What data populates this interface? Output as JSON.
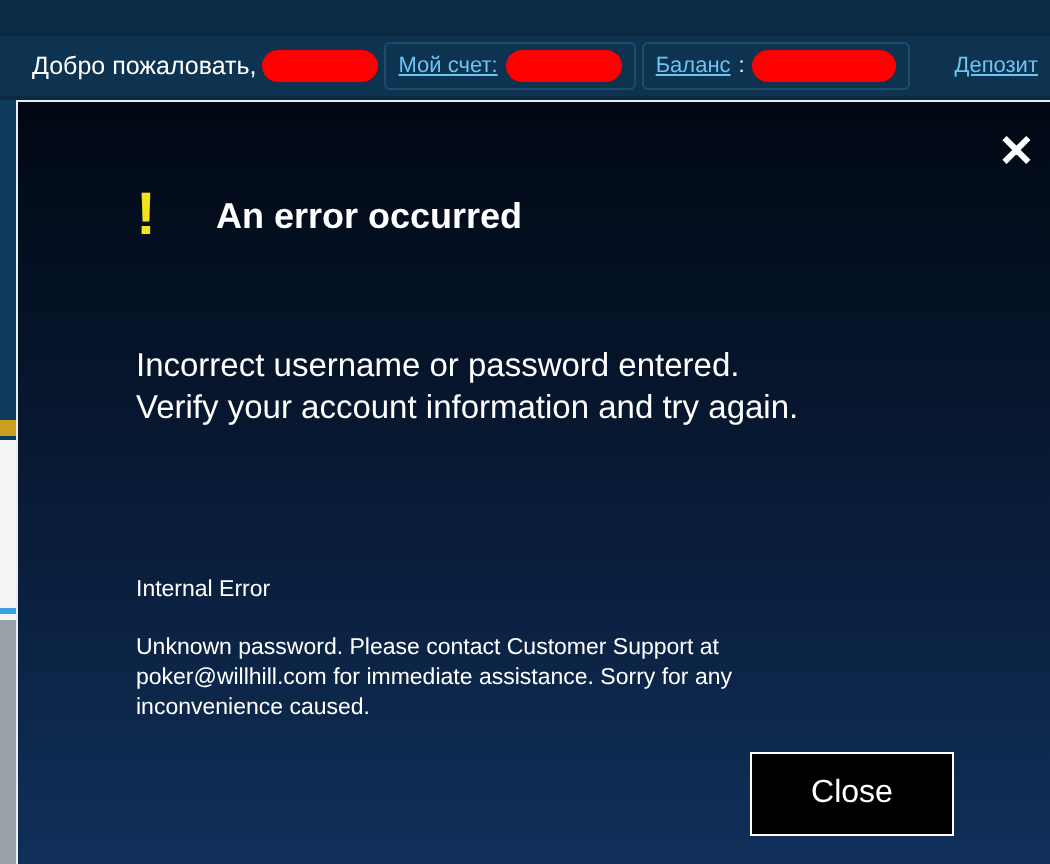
{
  "header": {
    "welcome": "Добро пожаловать,",
    "account_link": "Мой счет:",
    "balance_link": "Баланс",
    "balance_sep": ":",
    "deposit_link": "Депозит"
  },
  "dialog": {
    "close_icon": "✕",
    "alert_mark": "!",
    "title": "An error occurred",
    "message": "Incorrect username or password entered.\nVerify your account information and try again.",
    "error_label": "Internal Error",
    "details": "Unknown password. Please contact Customer Support at poker@willhill.com for immediate assistance. Sorry for any inconvenience caused.",
    "button": "Close"
  }
}
